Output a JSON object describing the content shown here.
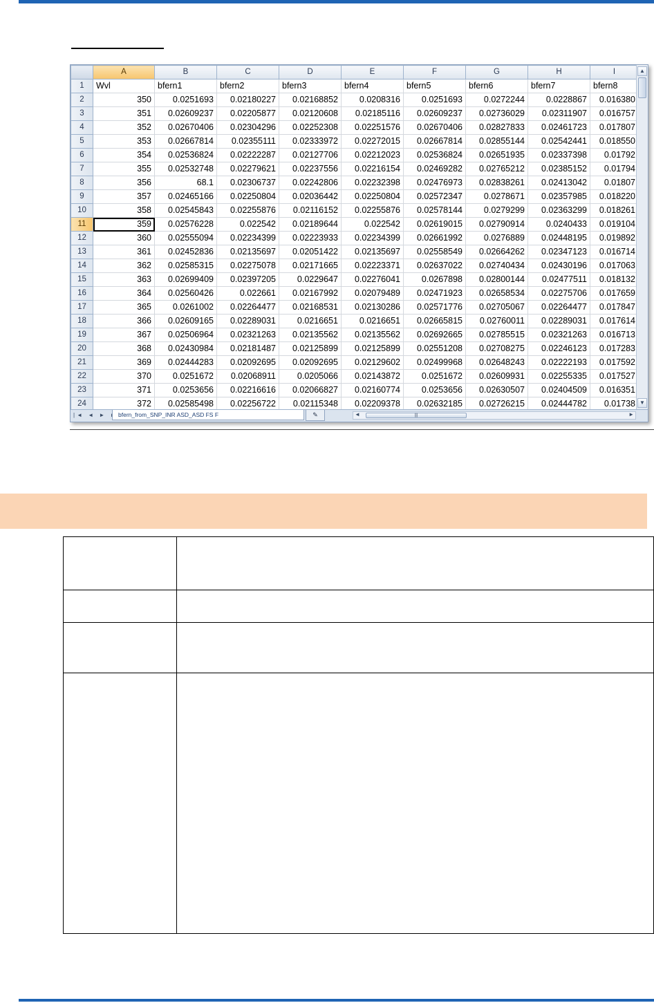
{
  "spreadsheet": {
    "column_headers": [
      "A",
      "B",
      "C",
      "D",
      "E",
      "F",
      "G",
      "H",
      "I"
    ],
    "active_column": "A",
    "active_row": "11",
    "header_row": {
      "row_number": "1",
      "cells": [
        "Wvl",
        "bfern1",
        "bfern2",
        "bfern3",
        "bfern4",
        "bfern5",
        "bfern6",
        "bfern7",
        "bfern8"
      ]
    },
    "rows": [
      {
        "n": "2",
        "cells": [
          "350",
          "0.0251693",
          "0.02180227",
          "0.02168852",
          "0.0208316",
          "0.0251693",
          "0.0272244",
          "0.0228867",
          "0.016380"
        ]
      },
      {
        "n": "3",
        "cells": [
          "351",
          "0.02609237",
          "0.02205877",
          "0.02120608",
          "0.02185116",
          "0.02609237",
          "0.02736029",
          "0.02311907",
          "0.016757"
        ]
      },
      {
        "n": "4",
        "cells": [
          "352",
          "0.02670406",
          "0.02304296",
          "0.02252308",
          "0.02251576",
          "0.02670406",
          "0.02827833",
          "0.02461723",
          "0.017807"
        ]
      },
      {
        "n": "5",
        "cells": [
          "353",
          "0.02667814",
          "0.02355111",
          "0.02333972",
          "0.02272015",
          "0.02667814",
          "0.02855144",
          "0.02542441",
          "0.018550"
        ]
      },
      {
        "n": "6",
        "cells": [
          "354",
          "0.02536824",
          "0.02222287",
          "0.02127706",
          "0.02212023",
          "0.02536824",
          "0.02651935",
          "0.02337398",
          "0.01792"
        ]
      },
      {
        "n": "7",
        "cells": [
          "355",
          "0.02532748",
          "0.02279621",
          "0.02237556",
          "0.02216154",
          "0.02469282",
          "0.02765212",
          "0.02385152",
          "0.01794"
        ]
      },
      {
        "n": "8",
        "cells": [
          "356",
          "68.1",
          "0.02306737",
          "0.02242806",
          "0.02232398",
          "0.02476973",
          "0.02838261",
          "0.02413042",
          "0.01807"
        ]
      },
      {
        "n": "9",
        "cells": [
          "357",
          "0.02465166",
          "0.02250804",
          "0.02036442",
          "0.02250804",
          "0.02572347",
          "0.0278671",
          "0.02357985",
          "0.018220"
        ]
      },
      {
        "n": "10",
        "cells": [
          "358",
          "0.02545843",
          "0.02255876",
          "0.02116152",
          "0.02255876",
          "0.02578144",
          "0.0279299",
          "0.02363299",
          "0.018261"
        ]
      },
      {
        "n": "11",
        "cells": [
          "359",
          "0.02576228",
          "0.022542",
          "0.02189644",
          "0.022542",
          "0.02619015",
          "0.02790914",
          "0.0240433",
          "0.019104"
        ]
      },
      {
        "n": "12",
        "cells": [
          "360",
          "0.02555094",
          "0.02234399",
          "0.02223933",
          "0.02234399",
          "0.02661992",
          "0.0276889",
          "0.02448195",
          "0.019892"
        ]
      },
      {
        "n": "13",
        "cells": [
          "361",
          "0.02452836",
          "0.02135697",
          "0.02051422",
          "0.02135697",
          "0.02558549",
          "0.02664262",
          "0.02347123",
          "0.016714"
        ]
      },
      {
        "n": "14",
        "cells": [
          "362",
          "0.02585315",
          "0.02275078",
          "0.02171665",
          "0.02223371",
          "0.02637022",
          "0.02740434",
          "0.02430196",
          "0.017063"
        ]
      },
      {
        "n": "15",
        "cells": [
          "363",
          "0.02699409",
          "0.02397205",
          "0.0229647",
          "0.02276041",
          "0.0267898",
          "0.02800144",
          "0.02477511",
          "0.018132"
        ]
      },
      {
        "n": "16",
        "cells": [
          "364",
          "0.02560426",
          "0.022661",
          "0.02167992",
          "0.02079489",
          "0.02471923",
          "0.02658534",
          "0.02275706",
          "0.017659"
        ]
      },
      {
        "n": "17",
        "cells": [
          "365",
          "0.0261002",
          "0.02264477",
          "0.02168531",
          "0.02130286",
          "0.02571776",
          "0.02705067",
          "0.02264477",
          "0.017847"
        ]
      },
      {
        "n": "18",
        "cells": [
          "366",
          "0.02609165",
          "0.02289031",
          "0.0216651",
          "0.0216651",
          "0.02665815",
          "0.02760011",
          "0.02289031",
          "0.017614"
        ]
      },
      {
        "n": "19",
        "cells": [
          "367",
          "0.02506964",
          "0.02321263",
          "0.02135562",
          "0.02135562",
          "0.02692665",
          "0.02785515",
          "0.02321263",
          "0.016713"
        ]
      },
      {
        "n": "20",
        "cells": [
          "368",
          "0.02430984",
          "0.02181487",
          "0.02125899",
          "0.02125899",
          "0.02551208",
          "0.02708275",
          "0.02246123",
          "0.017283"
        ]
      },
      {
        "n": "21",
        "cells": [
          "369",
          "0.02444283",
          "0.02092695",
          "0.02092695",
          "0.02129602",
          "0.02499968",
          "0.02648243",
          "0.02222193",
          "0.017592"
        ]
      },
      {
        "n": "22",
        "cells": [
          "370",
          "0.0251672",
          "0.02068911",
          "0.0205066",
          "0.02143872",
          "0.0251672",
          "0.02609931",
          "0.02255335",
          "0.017527"
        ]
      },
      {
        "n": "23",
        "cells": [
          "371",
          "0.0253656",
          "0.02216616",
          "0.02066827",
          "0.02160774",
          "0.0253656",
          "0.02630507",
          "0.02404509",
          "0.016351"
        ]
      },
      {
        "n": "24",
        "cells": [
          "372",
          "0.02585498",
          "0.02256722",
          "0.02115348",
          "0.02209378",
          "0.02632185",
          "0.02726215",
          "0.02444782",
          "0.01738"
        ]
      }
    ],
    "sheet_tab": "bfern_from_SNP_INR ASD_ASD FS F",
    "new_sheet_icon": "insert-worksheet-icon",
    "nav_arrows": "|◄ ◄ ► ►|",
    "scroll_grip": "|||"
  },
  "colors": {
    "rule_blue": "#1f64b4",
    "band_peach": "#fbd5b5",
    "header_active": "#f7c56d"
  }
}
